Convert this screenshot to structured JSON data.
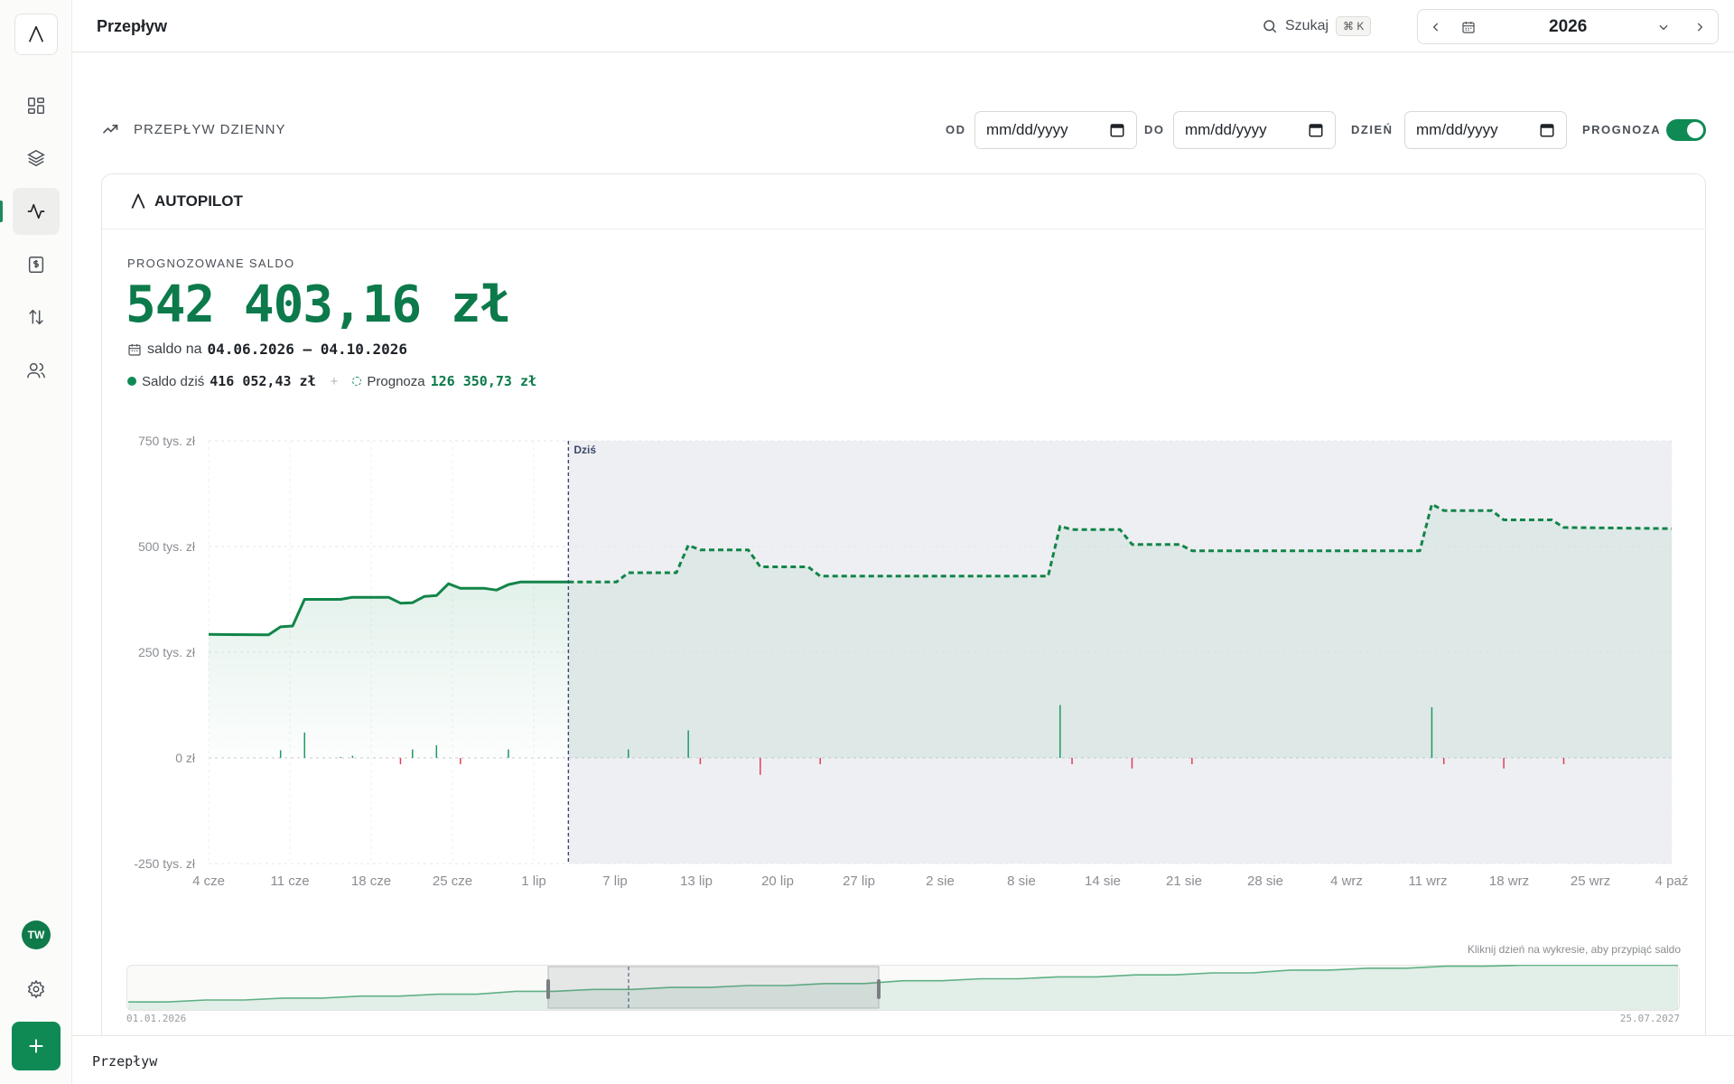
{
  "app": {
    "logo_letter": "Λ"
  },
  "sidebar": {
    "items": [
      {
        "name": "dashboard",
        "icon": "grid-icon"
      },
      {
        "name": "layers",
        "icon": "layers-icon"
      },
      {
        "name": "flow",
        "icon": "activity-icon",
        "active": true
      },
      {
        "name": "invoices",
        "icon": "invoice-icon"
      },
      {
        "name": "transfers",
        "icon": "arrows-up-down-icon"
      },
      {
        "name": "users",
        "icon": "users-icon"
      }
    ],
    "avatar_initials": "TW",
    "accent": "#108a55"
  },
  "topbar": {
    "title": "Przepływ",
    "search_label": "Szukaj",
    "search_shortcut": "⌘ K",
    "year": "2026"
  },
  "section": {
    "title": "PRZEPŁYW DZIENNY",
    "filter_from_label": "OD",
    "filter_to_label": "DO",
    "filter_day_label": "DZIEŃ",
    "date_placeholder": "mm/dd/yyyy",
    "forecast_label": "PROGNOZA",
    "forecast_on": true
  },
  "card": {
    "title": "AUTOPILOT",
    "kpi_label": "PROGNOZOWANE SALDO",
    "kpi_value": "542 403,16 zł",
    "range_prefix": "saldo na",
    "range_value": "04.06.2026 – 04.10.2026",
    "today_label": "Saldo dziś",
    "today_value": "416 052,43 zł",
    "plus": "+",
    "forecast_label": "Prognoza",
    "forecast_value": "126 350,73 zł",
    "brush_hint": "Kliknij dzień na wykresie, aby przypiąć saldo"
  },
  "chart_data": {
    "type": "line",
    "today_marker": "Dziś",
    "y_ticks": [
      "750 tys. zł",
      "500 tys. zł",
      "250 tys. zł",
      "0 zł",
      "-250 tys. zł"
    ],
    "ylim": [
      -250000,
      750000
    ],
    "x_ticks": [
      "4 cze",
      "11 cze",
      "18 cze",
      "25 cze",
      "1 lip",
      "7 lip",
      "13 lip",
      "20 lip",
      "27 lip",
      "2 sie",
      "8 sie",
      "14 sie",
      "21 sie",
      "28 sie",
      "4 wrz",
      "11 wrz",
      "18 wrz",
      "25 wrz",
      "4 paź"
    ],
    "x_day_range": [
      0,
      122
    ],
    "today_day": 30,
    "series": [
      {
        "kind": "actual",
        "points": [
          [
            0,
            292000
          ],
          [
            5,
            291000
          ],
          [
            6,
            310000
          ],
          [
            7,
            312000
          ],
          [
            8,
            375000
          ],
          [
            11,
            375000
          ],
          [
            12,
            380000
          ],
          [
            15,
            380000
          ],
          [
            16,
            366000
          ],
          [
            17,
            367000
          ],
          [
            18,
            382000
          ],
          [
            19,
            384000
          ],
          [
            20,
            412000
          ],
          [
            21,
            401000
          ],
          [
            23,
            401000
          ],
          [
            24,
            397000
          ],
          [
            25,
            410000
          ],
          [
            26,
            416000
          ],
          [
            30,
            416052
          ]
        ]
      },
      {
        "kind": "forecast",
        "points": [
          [
            30,
            416052
          ],
          [
            34,
            416000
          ],
          [
            35,
            438000
          ],
          [
            39,
            438000
          ],
          [
            40,
            503000
          ],
          [
            41,
            492000
          ],
          [
            45,
            492000
          ],
          [
            46,
            452000
          ],
          [
            50,
            452000
          ],
          [
            51,
            430000
          ],
          [
            70,
            430000
          ],
          [
            71,
            548000
          ],
          [
            72,
            540000
          ],
          [
            76,
            540000
          ],
          [
            77,
            505000
          ],
          [
            81,
            505000
          ],
          [
            82,
            490000
          ],
          [
            101,
            490000
          ],
          [
            102,
            600000
          ],
          [
            103,
            585000
          ],
          [
            107,
            585000
          ],
          [
            108,
            563000
          ],
          [
            112,
            563000
          ],
          [
            113,
            545000
          ],
          [
            122,
            542403
          ]
        ]
      }
    ],
    "flows": [
      [
        6,
        18000
      ],
      [
        8,
        60000
      ],
      [
        11,
        2000
      ],
      [
        12,
        5000
      ],
      [
        16,
        -15000
      ],
      [
        17,
        20000
      ],
      [
        19,
        30000
      ],
      [
        21,
        -15000
      ],
      [
        25,
        20000
      ],
      [
        35,
        20000
      ],
      [
        40,
        65000
      ],
      [
        41,
        -15000
      ],
      [
        46,
        -40000
      ],
      [
        51,
        -15000
      ],
      [
        71,
        125000
      ],
      [
        72,
        -15000
      ],
      [
        77,
        -25000
      ],
      [
        82,
        -15000
      ],
      [
        102,
        120000
      ],
      [
        103,
        -15000
      ],
      [
        108,
        -25000
      ],
      [
        113,
        -15000
      ]
    ],
    "brush": {
      "start_label": "01.01.2026",
      "end_label": "25.07.2027"
    }
  }
}
